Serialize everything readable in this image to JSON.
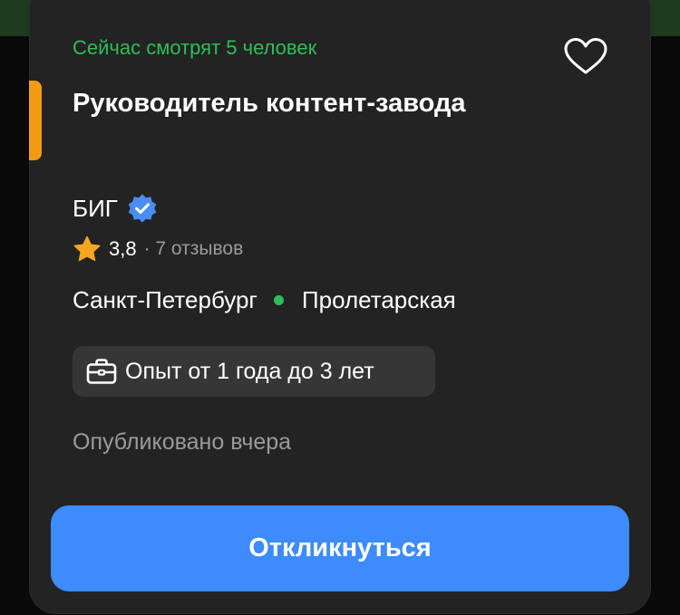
{
  "card": {
    "viewers_text": "Сейчас смотрят 5 человек",
    "title": "Руководитель контент-завода",
    "company": "БИГ",
    "rating": "3,8",
    "reviews": "· 7 отзывов",
    "city": "Санкт-Петербург",
    "metro": "Пролетарская",
    "experience": "Опыт от 1 года до 3 лет",
    "published": "Опубликовано вчера",
    "apply_label": "Откликнуться"
  },
  "icons": {
    "favorite": "heart-outline-icon",
    "verified": "verified-badge-icon",
    "rating": "star-icon",
    "experience": "briefcase-icon"
  },
  "colors": {
    "card_bg": "#232323",
    "accent_orange": "#f39c12",
    "viewers_green": "#2ebd59",
    "metro_green": "#2ebd59",
    "verified_blue": "#4a8ef5",
    "star_orange": "#f5a623",
    "chip_bg": "#363636",
    "button_blue": "#3d8bfd",
    "muted_text": "#9a9a9a"
  }
}
